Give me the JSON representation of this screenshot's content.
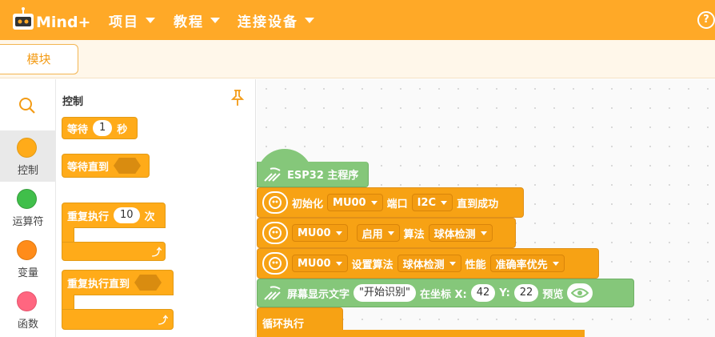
{
  "header": {
    "logo_text": "Mind+",
    "menus": [
      {
        "label": "项目"
      },
      {
        "label": "教程"
      },
      {
        "label": "连接设备"
      }
    ],
    "help_glyph": "?"
  },
  "tabs": {
    "modules_label": "模块"
  },
  "categories": [
    {
      "label": "",
      "icon": "search-icon"
    },
    {
      "label": "控制",
      "color": "#ffab19"
    },
    {
      "label": "运算符",
      "color": "#40bf4a"
    },
    {
      "label": "变量",
      "color": "#ff8c1a"
    },
    {
      "label": "函数",
      "color": "#ff6680"
    }
  ],
  "flyout": {
    "title": "控制",
    "wait": {
      "label": "等待",
      "value": "1",
      "unit": "秒"
    },
    "wait_until": {
      "label": "等待直到"
    },
    "repeat": {
      "label": "重复执行",
      "value": "10",
      "unit": "次"
    },
    "repeat_until": {
      "label": "重复执行直到"
    }
  },
  "workspace": {
    "main": {
      "label": "ESP32 主程序"
    },
    "init": {
      "label": "初始化",
      "device": "MU00",
      "port_label": "端口",
      "port": "I2C",
      "suffix": "直到成功"
    },
    "enable": {
      "device": "MU00",
      "mode": "启用",
      "algo_label": "算法",
      "algo": "球体检测"
    },
    "setalgo": {
      "device": "MU00",
      "label": "设置算法",
      "algo": "球体检测",
      "perf_label": "性能",
      "perf": "准确率优先"
    },
    "display": {
      "label": "屏幕显示文字",
      "text": "\"开始识别\"",
      "pos_label": "在坐标 X:",
      "x": "42",
      "y_label": "Y:",
      "y": "22",
      "preview_label": "预览"
    },
    "loop": {
      "label": "循环执行"
    }
  },
  "colors": {
    "topbar": "#ffa927",
    "control": "#ffab19",
    "extension": "#85c77a"
  }
}
